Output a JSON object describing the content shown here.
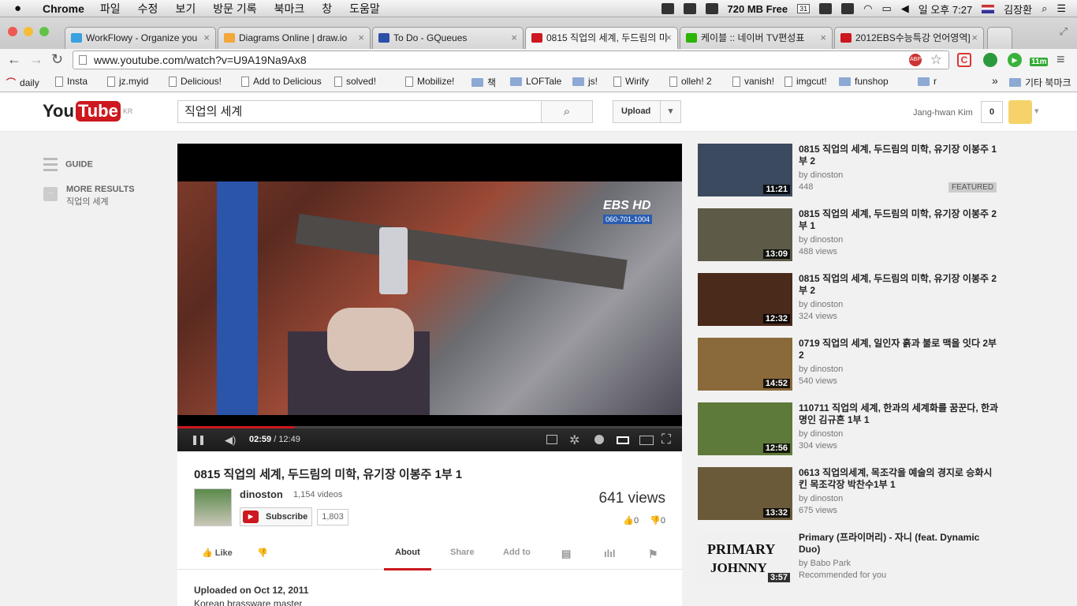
{
  "mac_menu": {
    "app": "Chrome",
    "items": [
      "파일",
      "수정",
      "보기",
      "방문 기록",
      "북마크",
      "창",
      "도움말"
    ],
    "memory": "720 MB Free",
    "calendar_day": "31",
    "clock": "일 오후 7:27",
    "user": "김장환"
  },
  "tabs": [
    {
      "title": "WorkFlowy - Organize you",
      "color": "#3aa0e0"
    },
    {
      "title": "Diagrams Online | draw.io",
      "color": "#f2a83a"
    },
    {
      "title": "To Do - GQueues",
      "color": "#2b4fa8"
    },
    {
      "title": "0815 직업의 세계, 두드림의 미",
      "color": "#cc181e"
    },
    {
      "title": "케이블 :: 네이버 TV편성표",
      "color": "#2db400"
    },
    {
      "title": "2012EBS수능특강 언어영역]",
      "color": "#cc181e"
    }
  ],
  "address": "www.youtube.com/watch?v=U9A19Na9Ax8",
  "toolbar_badge": "11m",
  "bookmarks": [
    {
      "label": "daily",
      "kind": "special"
    },
    {
      "label": "Insta",
      "kind": "page"
    },
    {
      "label": "jz.myid",
      "kind": "page"
    },
    {
      "label": "Delicious!",
      "kind": "page"
    },
    {
      "label": "Add to Delicious",
      "kind": "page"
    },
    {
      "label": "solved!",
      "kind": "page"
    },
    {
      "label": "Mobilize!",
      "kind": "page"
    },
    {
      "label": "책",
      "kind": "folder"
    },
    {
      "label": "LOFTale",
      "kind": "folder"
    },
    {
      "label": "js!",
      "kind": "folder"
    },
    {
      "label": "Wirify",
      "kind": "page"
    },
    {
      "label": "olleh! 2",
      "kind": "page"
    },
    {
      "label": "vanish!",
      "kind": "page"
    },
    {
      "label": "imgcut!",
      "kind": "page"
    },
    {
      "label": "funshop",
      "kind": "folder"
    },
    {
      "label": "r",
      "kind": "folder"
    }
  ],
  "bookmarks_more": "»",
  "bookmarks_other": "기타 북마크",
  "youtube": {
    "logo_you": "You",
    "logo_tube": "Tube",
    "region": "KR",
    "search_value": "직업의 세계",
    "upload": "Upload",
    "user": "Jang-hwan Kim",
    "notifications": "0"
  },
  "guide": {
    "label": "GUIDE",
    "more_results": "MORE RESULTS",
    "more_sub": "직업의 세계"
  },
  "player": {
    "current": "02:59",
    "duration": "/ 12:49",
    "progress_fraction": 0.233,
    "watermark": "EBS HD",
    "watermark_sub": "060-701-1004"
  },
  "video": {
    "title": "0815 직업의 세계, 두드림의 미학, 유기장 이봉주 1부 1",
    "channel": "dinoston",
    "channel_videos": "1,154 videos",
    "subscribe": "Subscribe",
    "subscribers": "1,803",
    "views": "641 views",
    "likes": "0",
    "dislikes": "0",
    "like_label": "Like",
    "tabs": [
      "About",
      "Share",
      "Add to"
    ],
    "uploaded": "Uploaded on Oct 12, 2011",
    "description": "Korean brassware master"
  },
  "related": [
    {
      "title": "0815 직업의 세계, 두드림의 미학, 유기장 이봉주 1부 2",
      "by": "by dinoston",
      "views": "448",
      "duration": "11:21",
      "featured": "FEATURED",
      "color": "#3b4a5e"
    },
    {
      "title": "0815 직업의 세계, 두드림의 미학, 유기장 이봉주 2부 1",
      "by": "by dinoston",
      "views": "488 views",
      "duration": "13:09",
      "color": "#5d5a48"
    },
    {
      "title": "0815 직업의 세계, 두드림의 미학, 유기장 이봉주 2부 2",
      "by": "by dinoston",
      "views": "324 views",
      "duration": "12:32",
      "color": "#4a2a1a"
    },
    {
      "title": "0719 직업의 세계, 일인자 흙과 불로 맥을 잇다 2부 2",
      "by": "by dinoston",
      "views": "540 views",
      "duration": "14:52",
      "color": "#8a6a3a"
    },
    {
      "title": "110711 직업의 세계, 한과의 세계화를 꿈꾼다, 한과 명인 김규흔 1부 1",
      "by": "by dinoston",
      "views": "304 views",
      "duration": "12:56",
      "color": "#5e7a3a"
    },
    {
      "title": "0613 직업의세계, 목조각을 예술의 경지로 승화시킨 목조각장 박찬수1부 1",
      "by": "by dinoston",
      "views": "675 views",
      "duration": "13:32",
      "color": "#6a5a3a"
    },
    {
      "title": "Primary (프라이머리) - 자니 (feat. Dynamic Duo)",
      "by": "by Babo Park",
      "views": "Recommended for you",
      "duration": "3:57",
      "color": "#f0f0f0",
      "thumb_text": "PRIMARY",
      "thumb_text2": "JOHNNY"
    }
  ]
}
